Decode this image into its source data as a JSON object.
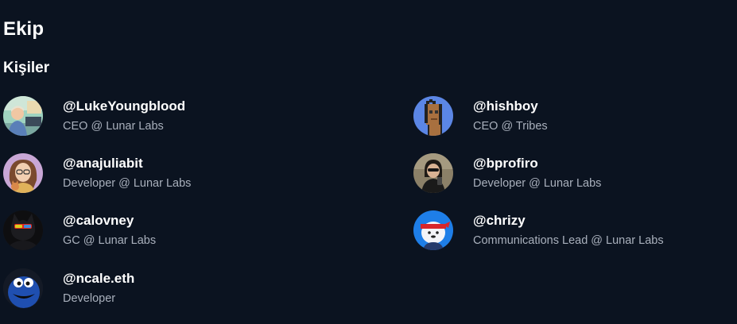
{
  "section": {
    "title": "Ekip",
    "subtitle": "Kişiler"
  },
  "people": [
    {
      "handle": "@LukeYoungblood",
      "role": "CEO @ Lunar Labs",
      "avatar": "illustrated-man-at-desk"
    },
    {
      "handle": "@hishboy",
      "role": "CEO @ Tribes",
      "avatar": "pixel-punk"
    },
    {
      "handle": "@anajuliabit",
      "role": "Developer @ Lunar Labs",
      "avatar": "illustrated-woman-with-cat"
    },
    {
      "handle": "@bprofiro",
      "role": "Developer @ Lunar Labs",
      "avatar": "photo-mirror-selfie"
    },
    {
      "handle": "@calovney",
      "role": "GC @ Lunar Labs",
      "avatar": "dark-creature-with-sunglasses"
    },
    {
      "handle": "@chrizy",
      "role": "Communications Lead @ Lunar Labs",
      "avatar": "cartoon-character-headband"
    },
    {
      "handle": "@ncale.eth",
      "role": "Developer",
      "avatar": "blue-furry-monster"
    }
  ],
  "colors": {
    "background": "#0b1320",
    "text_primary": "#ffffff",
    "text_secondary": "#a9b0bc"
  }
}
